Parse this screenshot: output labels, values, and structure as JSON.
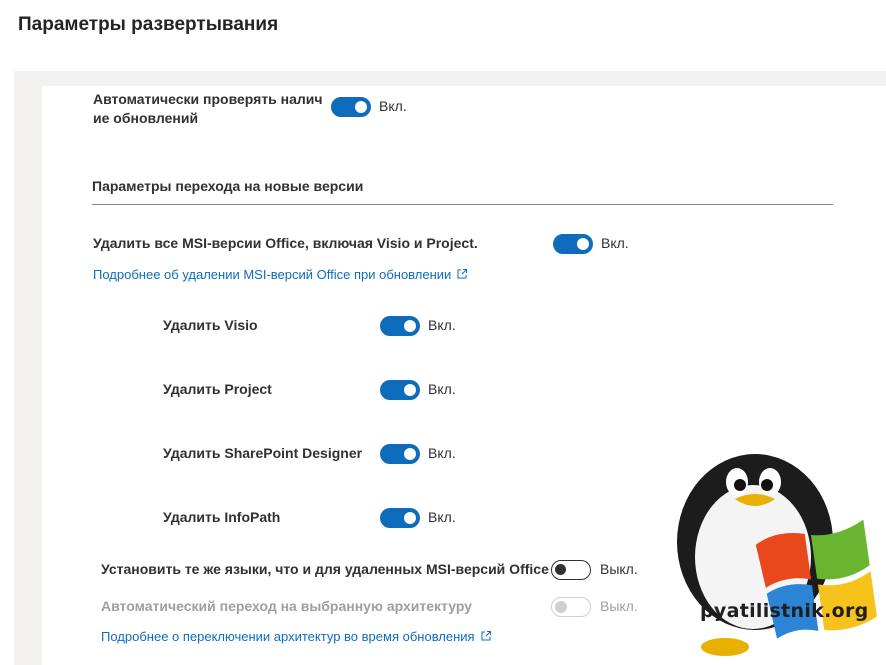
{
  "page": {
    "title": "Параметры развертывания"
  },
  "auto_update": {
    "label_line1": "Автоматически проверять налич",
    "label_line2": "ие обновлений",
    "state": "Вкл.",
    "on": true
  },
  "upgrade_section": {
    "title": "Параметры перехода на новые версии"
  },
  "remove_msi": {
    "label": "Удалить все MSI-версии Office, включая Visio и Project.",
    "state": "Вкл.",
    "on": true,
    "link": "Подробнее об удалении MSI-версий Office при обновлении"
  },
  "sub_options": [
    {
      "label": "Удалить Visio",
      "state": "Вкл.",
      "on": true
    },
    {
      "label": "Удалить Project",
      "state": "Вкл.",
      "on": true
    },
    {
      "label": "Удалить SharePoint Designer",
      "state": "Вкл.",
      "on": true
    },
    {
      "label": "Удалить InfoPath",
      "state": "Вкл.",
      "on": true
    }
  ],
  "same_languages": {
    "label": "Установить те же языки, что и для удаленных MSI-версий Office",
    "state": "Выкл.",
    "on": false
  },
  "auto_arch": {
    "label": "Автоматический переход на выбранную архитектуру",
    "state": "Выкл.",
    "on": false,
    "disabled": true
  },
  "arch_link": {
    "label": "Подробнее о переключении архитектур во время обновления"
  },
  "watermark": {
    "text": "pyatilistnik.org"
  },
  "colors": {
    "accent": "#0f6cbd",
    "text": "#323130",
    "disabled": "#a19f9d",
    "panel": "#f3f2f1"
  }
}
